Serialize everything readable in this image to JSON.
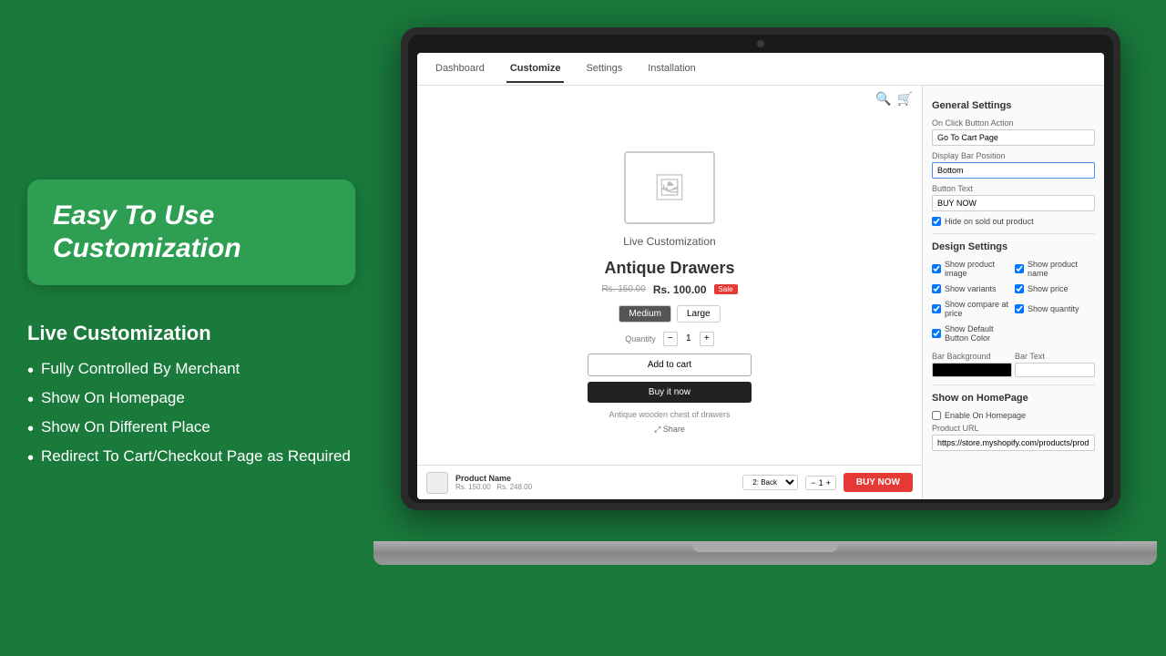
{
  "background_color": "#1a7a3c",
  "headline": {
    "text": "Easy To Use Customization"
  },
  "features": {
    "title": "Live Customization",
    "items": [
      "Fully Controlled By Merchant",
      "Show On Homepage",
      "Show On Different Place",
      "Redirect To Cart/Checkout Page as Required"
    ]
  },
  "nav": {
    "tabs": [
      "Dashboard",
      "Customize",
      "Settings",
      "Installation"
    ],
    "active_tab": "Customize"
  },
  "preview": {
    "live_label": "Live Customization",
    "product_name": "Antique Drawers",
    "price_original": "Rs. 150.00",
    "price_current": "Rs. 100.00",
    "sale_badge": "Sale",
    "sizes": [
      "Medium",
      "Large"
    ],
    "active_size": "Medium",
    "quantity_label": "Quantity",
    "qty_value": "1",
    "add_to_cart": "Add to cart",
    "buy_now": "Buy it now",
    "description": "Antique wooden chest of drawers",
    "share": "⤢ Share"
  },
  "sticky_bar": {
    "product_name": "Product Name",
    "price_original": "Rs. 150.00",
    "price_current": "Rs. 248.00",
    "back_option": "2: Back",
    "qty": "1",
    "buy_label": "BUY NOW"
  },
  "settings": {
    "general_title": "General Settings",
    "on_click_label": "On Click Button Action",
    "on_click_value": "Go To Cart Page",
    "display_position_label": "Display Bar Position",
    "display_position_value": "Bottom",
    "button_text_label": "Button Text",
    "button_text_value": "BUY NOW",
    "hide_sold_out_label": "Hide on sold out product",
    "hide_sold_out_checked": true,
    "design_title": "Design Settings",
    "design_checkboxes": [
      {
        "label": "Show product image",
        "checked": true
      },
      {
        "label": "Show product name",
        "checked": true
      },
      {
        "label": "Show variants",
        "checked": true
      },
      {
        "label": "Show price",
        "checked": true
      },
      {
        "label": "Show compare at price",
        "checked": true
      },
      {
        "label": "Show quantity",
        "checked": true
      },
      {
        "label": "Show Default Button Color",
        "checked": true
      }
    ],
    "bar_background_label": "Bar Background",
    "bar_text_label": "Bar Text",
    "homepage_title": "Show on HomePage",
    "enable_homepage_label": "Enable On Homepage",
    "enable_homepage_checked": false,
    "product_url_label": "Product URL",
    "product_url_value": "https://store.myshopify.com/products/product"
  }
}
